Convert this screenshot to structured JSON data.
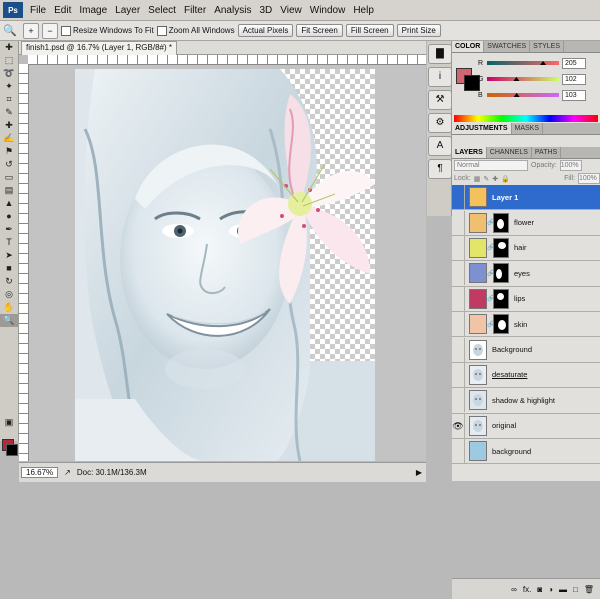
{
  "menubar": {
    "logo": "Ps",
    "items": [
      "File",
      "Edit",
      "Image",
      "Layer",
      "Select",
      "Filter",
      "Analysis",
      "3D",
      "View",
      "Window",
      "Help"
    ]
  },
  "options": {
    "resize_windows": "Resize Windows To Fit",
    "zoom_all_windows": "Zoom All Windows",
    "actual_pixels": "Actual Pixels",
    "fit_screen": "Fit Screen",
    "fill_screen": "Fill Screen",
    "print_size": "Print Size"
  },
  "document": {
    "tab_title": "finish1.psd @ 16.7% (Layer 1, RGB/8#) *"
  },
  "status": {
    "zoom": "16.67%",
    "doc_size": "Doc: 30.1M/136.3M"
  },
  "panels": {
    "color_tabs": [
      "COLOR",
      "SWATCHES",
      "STYLES"
    ],
    "color": {
      "r_label": "R",
      "g_label": "G",
      "b_label": "B",
      "r": "205",
      "g": "102",
      "b": "103",
      "r_fraction": 0.804,
      "g_fraction": 0.4,
      "b_fraction": 0.404,
      "foreground": "#cd6667"
    },
    "adj_tabs": [
      "ADJUSTMENTS",
      "MASKS"
    ],
    "layers_tabs": [
      "LAYERS",
      "CHANNELS",
      "PATHS"
    ],
    "blend_mode": "Normal",
    "opacity_label": "Opacity:",
    "opacity": "100%",
    "lock_label": "Lock:",
    "fill_label": "Fill:",
    "fill": "100%"
  },
  "layers": [
    {
      "name": "Layer 1",
      "color": "#f4c15c",
      "visible": false,
      "selected": true,
      "mask": false,
      "bold": true
    },
    {
      "name": "flower",
      "color": "#f0c070",
      "visible": false,
      "selected": false,
      "mask": true
    },
    {
      "name": "hair",
      "color": "#e3e46a",
      "visible": false,
      "selected": false,
      "mask": true
    },
    {
      "name": "eyes",
      "color": "#7d90cf",
      "visible": false,
      "selected": false,
      "mask": true
    },
    {
      "name": "lips",
      "color": "#c03a64",
      "visible": false,
      "selected": false,
      "mask": true
    },
    {
      "name": "skin",
      "color": "#f0c4a4",
      "visible": false,
      "selected": false,
      "mask": true
    },
    {
      "name": "Background",
      "color": "#ffffff",
      "visible": false,
      "selected": false,
      "mask": false,
      "face": true
    },
    {
      "name": "desaturate",
      "color": "#e8eef2",
      "visible": false,
      "selected": false,
      "mask": false,
      "underline": true,
      "face": true
    },
    {
      "name": "shadow & highlight",
      "color": "#dde6ec",
      "visible": false,
      "selected": false,
      "mask": false,
      "face": true
    },
    {
      "name": "original",
      "color": "#e3ecf1",
      "visible": true,
      "selected": false,
      "mask": false,
      "face": true
    },
    {
      "name": "background",
      "color": "#9ec9e2",
      "visible": false,
      "selected": false,
      "mask": false
    }
  ],
  "layer_buttons": [
    "link-icon",
    "fx-icon",
    "mask-icon",
    "adjustment-icon",
    "group-icon",
    "new-layer-icon",
    "trash-icon"
  ],
  "colors": {
    "selected_layer": "#2f6bcc",
    "foreground_swatch": "#b3283a"
  }
}
